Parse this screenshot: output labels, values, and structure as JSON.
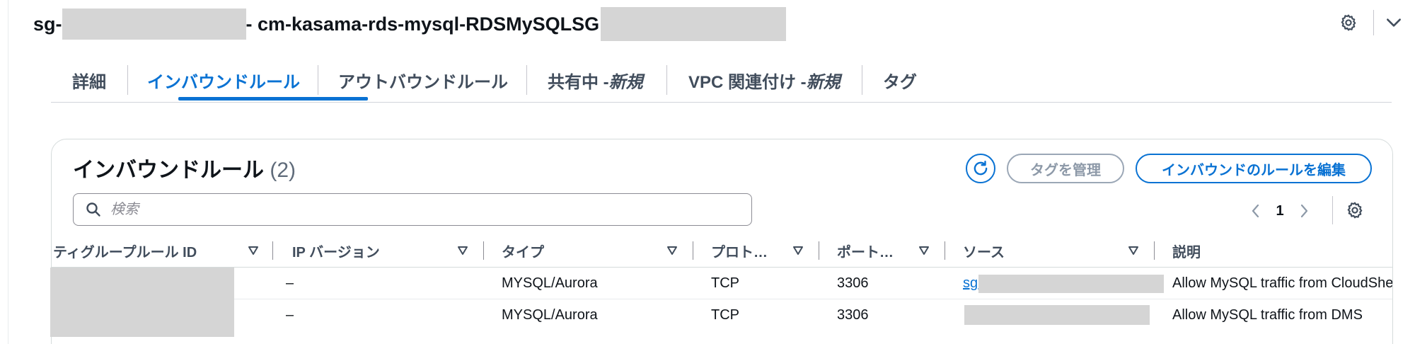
{
  "header": {
    "title_prefix": "sg-",
    "title_middle": "- cm-kasama-rds-mysql-RDSMySQLSG",
    "icons": {
      "settings": "gear-icon",
      "expand": "chevron-down-icon"
    }
  },
  "tabs": [
    {
      "label": "詳細",
      "new": ""
    },
    {
      "label": "インバウンドルール",
      "new": "",
      "active": true
    },
    {
      "label": "アウトバウンドルール",
      "new": ""
    },
    {
      "label": "共有中 - ",
      "new": "新規"
    },
    {
      "label": "VPC 関連付け - ",
      "new": "新規"
    },
    {
      "label": "タグ",
      "new": ""
    }
  ],
  "panel": {
    "title": "インバウンドルール",
    "count": "(2)",
    "buttons": {
      "refresh_icon": "refresh-icon",
      "manage_tags": "タグを管理",
      "edit_rules": "インバウンドのルールを編集"
    },
    "search": {
      "placeholder": "検索",
      "value": ""
    },
    "pagination": {
      "current_page": "1"
    }
  },
  "table": {
    "columns": [
      "ティグループルール ID",
      "IP バージョン",
      "タイプ",
      "プロト…",
      "ポート…",
      "ソース",
      "説明"
    ],
    "rows": [
      {
        "rule_id": "",
        "ip_version": "–",
        "type": "MYSQL/Aurora",
        "protocol": "TCP",
        "port": "3306",
        "source": "sg-",
        "description": "Allow MySQL traffic from CloudShell"
      },
      {
        "rule_id": "",
        "ip_version": "–",
        "type": "MYSQL/Aurora",
        "protocol": "TCP",
        "port": "3306",
        "source": "",
        "description": "Allow MySQL traffic from DMS"
      }
    ]
  },
  "colors": {
    "accent": "#0972d3",
    "text": "#0f141a",
    "muted": "#414d5c",
    "disabled": "#8d99a8",
    "redaction": "#d5d5d5"
  }
}
